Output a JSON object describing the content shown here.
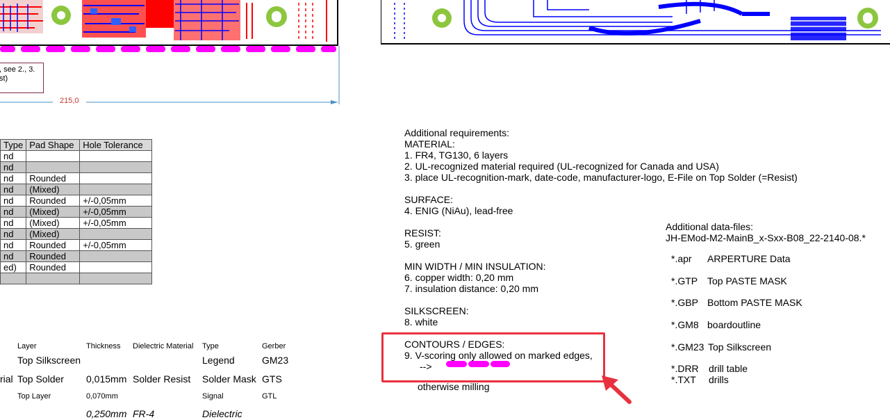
{
  "dimension": {
    "value": "215,0"
  },
  "callout": {
    "line1": ", see 2., 3.",
    "line2": "st)"
  },
  "drill_table": {
    "headers": [
      "Type",
      "Pad Shape",
      "Hole Tolerance"
    ],
    "rows": [
      [
        "nd",
        "",
        ""
      ],
      [
        "nd",
        "",
        ""
      ],
      [
        "nd",
        "Rounded",
        ""
      ],
      [
        "nd",
        "(Mixed)",
        ""
      ],
      [
        "nd",
        "Rounded",
        "+/-0,05mm"
      ],
      [
        "nd",
        "(Mixed)",
        "+/-0,05mm"
      ],
      [
        "nd",
        "(Mixed)",
        "+/-0,05mm"
      ],
      [
        "nd",
        "(Mixed)",
        ""
      ],
      [
        "nd",
        "Rounded",
        "+/-0,05mm"
      ],
      [
        "nd",
        "Rounded",
        ""
      ],
      [
        "ed)",
        "Rounded",
        ""
      ],
      [
        "",
        "",
        ""
      ]
    ]
  },
  "stackup": {
    "headers": {
      "layer": "Layer",
      "thickness": "Thickness",
      "dielectric": "Dielectric Material",
      "type": "Type",
      "gerber": "Gerber"
    },
    "row1": {
      "layer": "Top Silkscreen",
      "type": "Legend",
      "gerber": "GM23"
    },
    "row2": {
      "prefix": "rial",
      "layer": "Top Solder",
      "thickness": "0,015mm",
      "dielectric": "Solder Resist",
      "type": "Solder Mask",
      "gerber": "GTS"
    },
    "row3": {
      "layer": "Top Layer",
      "thickness": "0,070mm",
      "type": "Signal",
      "gerber": "GTL"
    },
    "row4": {
      "thickness": "0,250mm",
      "dielectric": "FR-4",
      "type": "Dielectric"
    }
  },
  "requirements": {
    "title": "Additional requirements:",
    "material_h": "MATERIAL:",
    "m1": "1.  FR4, TG130, 6 layers",
    "m2": "2.  UL-recognized material required (UL-recognized for Canada and USA)",
    "m3": "3.  place UL-recognition-mark, date-code, manufacturer-logo, E-File on Top Solder (=Resist)",
    "surface_h": "SURFACE:",
    "s4": "4.  ENIG (NiAu), lead-free",
    "resist_h": "RESIST:",
    "r5": "5.  green",
    "minwidth_h": "MIN WIDTH / MIN INSULATION:",
    "w6": "6.  copper width: 0,20 mm",
    "w7": "7.  insulation distance: 0,20 mm",
    "silk_h": "SILKSCREEN:",
    "k8": "8.  white",
    "contours_h": "CONTOURS / EDGES:",
    "c9": "9.  V-scoring only allowed on marked edges,",
    "arrow": "-->",
    "milling": "otherwise milling"
  },
  "datafiles": {
    "title": "Additional data-files:",
    "filename": "JH-EMod-M2-MainB_x-Sxx-B08_22-2140-08.*",
    "items": [
      {
        "ext": "*.apr",
        "desc": "ARPERTURE Data"
      },
      {
        "ext": "*.GTP",
        "desc": "Top PASTE MASK"
      },
      {
        "ext": "*.GBP",
        "desc": "Bottom PASTE MASK"
      },
      {
        "ext": "*.GM8",
        "desc": "boardoutline"
      },
      {
        "ext": "*.GM23",
        "desc": "Top Silkscreen"
      },
      {
        "ext": "*.DRR",
        "desc": "drill table"
      },
      {
        "ext": "*.TXT",
        "desc": "drills"
      }
    ]
  },
  "colors": {
    "highlight": "#e8313f",
    "magenta": "#ff00ff",
    "pcb_red": "#ff0000",
    "pcb_blue": "#0000ff",
    "pad_green": "#8cc63f",
    "dimension": "#4a90c8"
  }
}
